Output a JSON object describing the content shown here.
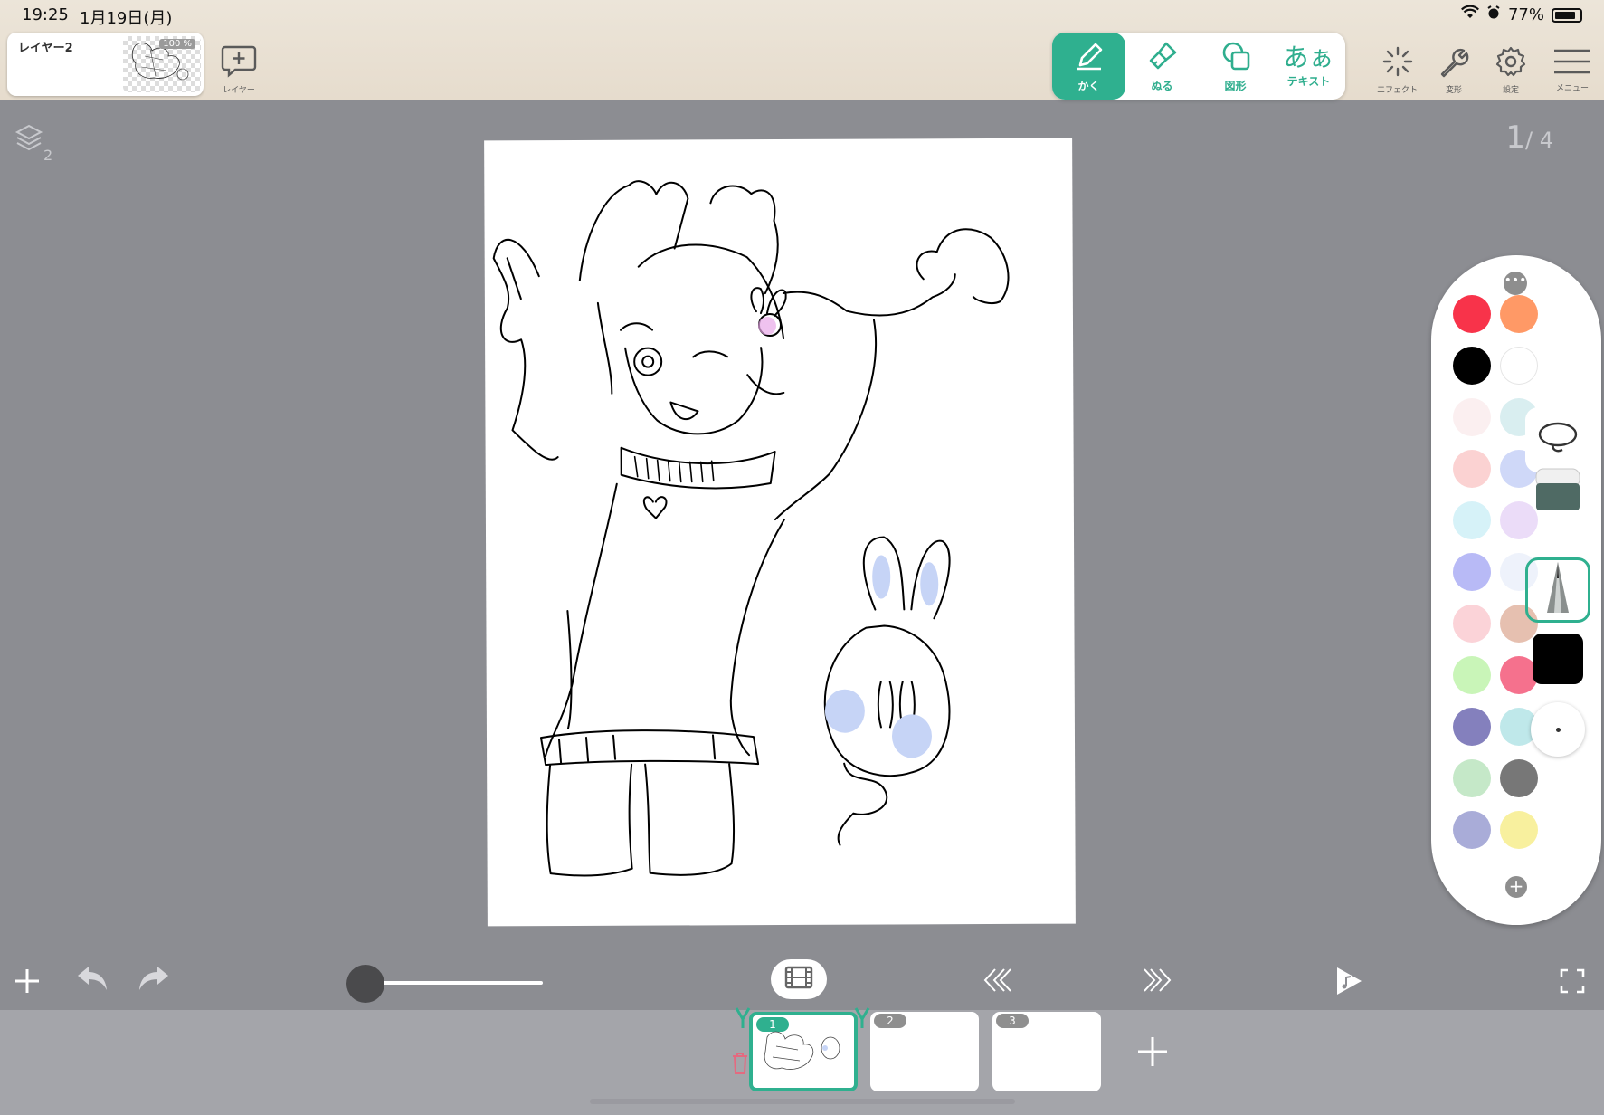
{
  "status_bar": {
    "time": "19:25",
    "date": "1月19日(月)",
    "battery": "77%"
  },
  "layer_chip": {
    "name": "レイヤー2",
    "opacity": "100 %"
  },
  "add_layer": {
    "label": "レイヤー"
  },
  "tools": [
    {
      "label": "かく",
      "icon": "pencil-icon",
      "active": true
    },
    {
      "label": "ぬる",
      "icon": "brush-icon",
      "active": false
    },
    {
      "label": "図形",
      "icon": "shape-icon",
      "active": false
    },
    {
      "label": "テキスト",
      "glyph": "あぁ",
      "icon": "text-icon",
      "active": false
    }
  ],
  "right_menu": [
    {
      "label": "エフェクト",
      "icon": "sparkle-icon"
    },
    {
      "label": "変形",
      "icon": "wrench-icon"
    },
    {
      "label": "設定",
      "icon": "gear-icon"
    },
    {
      "label": "メニュー",
      "icon": "hamburger-icon"
    }
  ],
  "layers_indicator": {
    "count": "2"
  },
  "page_counter": {
    "current": "1",
    "total": "/ 4"
  },
  "palette": {
    "swatches": [
      "#f8334a",
      "#ff9966",
      "#000000",
      "#ffffff",
      "#fbeff0",
      "#d9eef0",
      "#fbd2d2",
      "#cfd8f8",
      "#d6f2f8",
      "#ebdcf8",
      "#b8baf6",
      "#eef2fb",
      "#fbd3d8",
      "#e6c0b0",
      "#c9f5b8",
      "#f5718d",
      "#8480bd",
      "#bfe8ea",
      "#c5e8c8",
      "#777777",
      "#a9acd8",
      "#f8f09e"
    ],
    "current_color": "#000000"
  },
  "frames": [
    {
      "number": "1",
      "active": true
    },
    {
      "number": "2",
      "active": false
    },
    {
      "number": "3",
      "active": false
    }
  ]
}
